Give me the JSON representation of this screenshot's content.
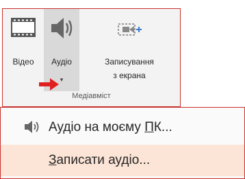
{
  "ribbon": {
    "buttons": [
      {
        "label": "Відео",
        "icon": "film-icon"
      },
      {
        "label": "Аудіо",
        "icon": "speaker-icon",
        "dropdown": true
      },
      {
        "label_line1": "Записування",
        "label_line2": "з екрана",
        "icon": "screen-recording-icon"
      }
    ],
    "group_title": "Медіавміст"
  },
  "menu": {
    "items": [
      {
        "prefix": "Аудіо на моєму ",
        "underlined": "П",
        "suffix": "К...",
        "icon": "speaker-icon"
      },
      {
        "underlined": "З",
        "suffix": "аписати аудіо..."
      }
    ]
  },
  "colors": {
    "accent": "#c9302c",
    "hover": "#fce4d6",
    "pressed": "#d9d9d9",
    "arrow": "#e02020"
  }
}
